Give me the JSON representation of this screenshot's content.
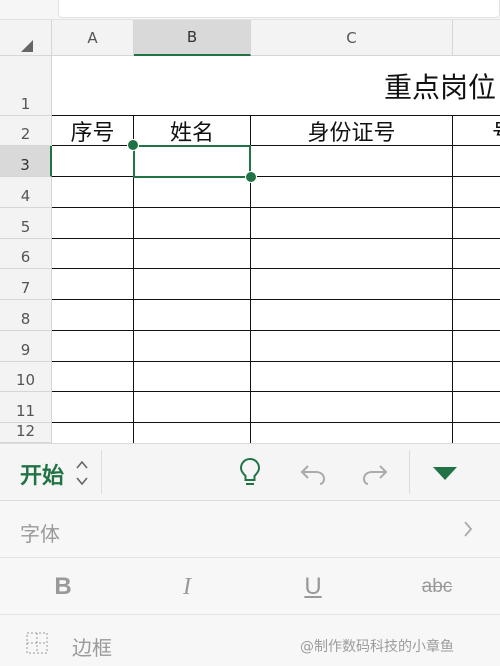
{
  "spreadsheet": {
    "columns": [
      "A",
      "B",
      "C"
    ],
    "rows": [
      "1",
      "2",
      "3",
      "4",
      "5",
      "6",
      "7",
      "8",
      "9",
      "10",
      "11",
      "12"
    ],
    "title_cell": "重点岗位",
    "headers": {
      "a2": "序号",
      "b2": "姓名",
      "c2": "身份证号",
      "d2": "号"
    },
    "selected_cell": "B3"
  },
  "toolbar": {
    "tab_label": "开始"
  },
  "panel": {
    "font_label": "字体",
    "bold_label": "B",
    "italic_label": "I",
    "underline_label": "U",
    "strike_label": "abc",
    "border_label": "边框"
  },
  "watermark": "@制作数码科技的小章鱼",
  "colors": {
    "accent": "#217346",
    "grid": "#111111",
    "header_bg": "#f3f3f3",
    "selected_header_bg": "#d9d9d9"
  }
}
